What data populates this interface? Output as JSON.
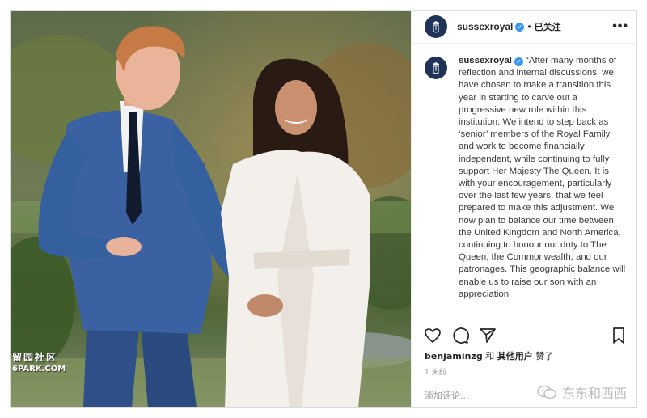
{
  "photo": {
    "watermark_line1": "留园社区",
    "watermark_line2": "6PARK.COM"
  },
  "header": {
    "username": "sussexroyal",
    "verified_mark": "✓",
    "separator": "•",
    "follow_state": "已关注",
    "more_icon": "•••"
  },
  "caption": {
    "username": "sussexroyal",
    "text": " “After many months of reflection and internal discussions, we have chosen to make a transition this year in starting to carve out a progressive new role within this institution. We intend to step back as ‘senior’ members of the Royal Family and work to become financially independent, while continuing to fully support Her Majesty The Queen. It is with your encouragement, particularly over the last few years, that we feel prepared to make this adjustment. We now plan to balance our time between the United Kingdom and North America, continuing to honour our duty to The Queen, the Commonwealth, and our patronages. This geographic balance will enable us to raise our son with an appreciation"
  },
  "actions": {
    "icons": [
      "heart-icon",
      "comment-icon",
      "share-icon",
      "bookmark-icon"
    ]
  },
  "likes": {
    "user": "benjaminzg",
    "connector": " 和 ",
    "others": "其他用户",
    "suffix": " 赞了"
  },
  "time_ago": "1 天前",
  "comment": {
    "placeholder": "添加评论..."
  },
  "brand": {
    "watermark": "东东和西西"
  },
  "colors": {
    "verified": "#3897f0",
    "avatar_bg": "#1f3357",
    "muted": "#8e8e8e",
    "border": "#efefef"
  }
}
